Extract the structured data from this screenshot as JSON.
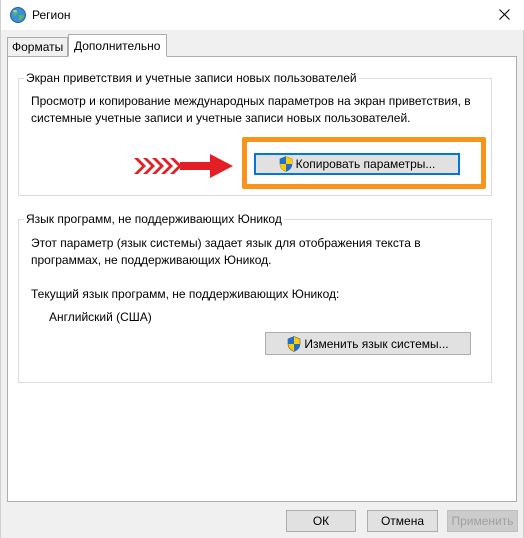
{
  "window": {
    "title": "Регион"
  },
  "tabs": [
    {
      "label": "Форматы",
      "active": false
    },
    {
      "label": "Дополнительно",
      "active": true
    }
  ],
  "welcome_group": {
    "legend": "Экран приветствия и учетные записи новых пользователей",
    "description_line1": "Просмотр и копирование международных параметров на экран приветствия, в",
    "description_line2": "системные учетные записи и учетные записи новых пользователей.",
    "copy_button": "Копировать параметры..."
  },
  "nonunicode_group": {
    "legend": "Язык программ, не поддерживающих Юникод",
    "description_line1": "Этот параметр (язык системы) задает язык для отображения текста в",
    "description_line2": "программах, не поддерживающих Юникод.",
    "current_label": "Текущий язык программ, не поддерживающих Юникод:",
    "current_value": "Английский (США)",
    "change_button": "Изменить язык системы..."
  },
  "footer": {
    "ok": "ОК",
    "cancel": "Отмена",
    "apply": "Применить"
  },
  "colors": {
    "highlight": "#f7941d",
    "arrow": "#e31e24",
    "focus": "#0078d7"
  },
  "icons": [
    "globe-icon",
    "close-icon",
    "uac-shield-icon",
    "red-arrow-icon"
  ]
}
